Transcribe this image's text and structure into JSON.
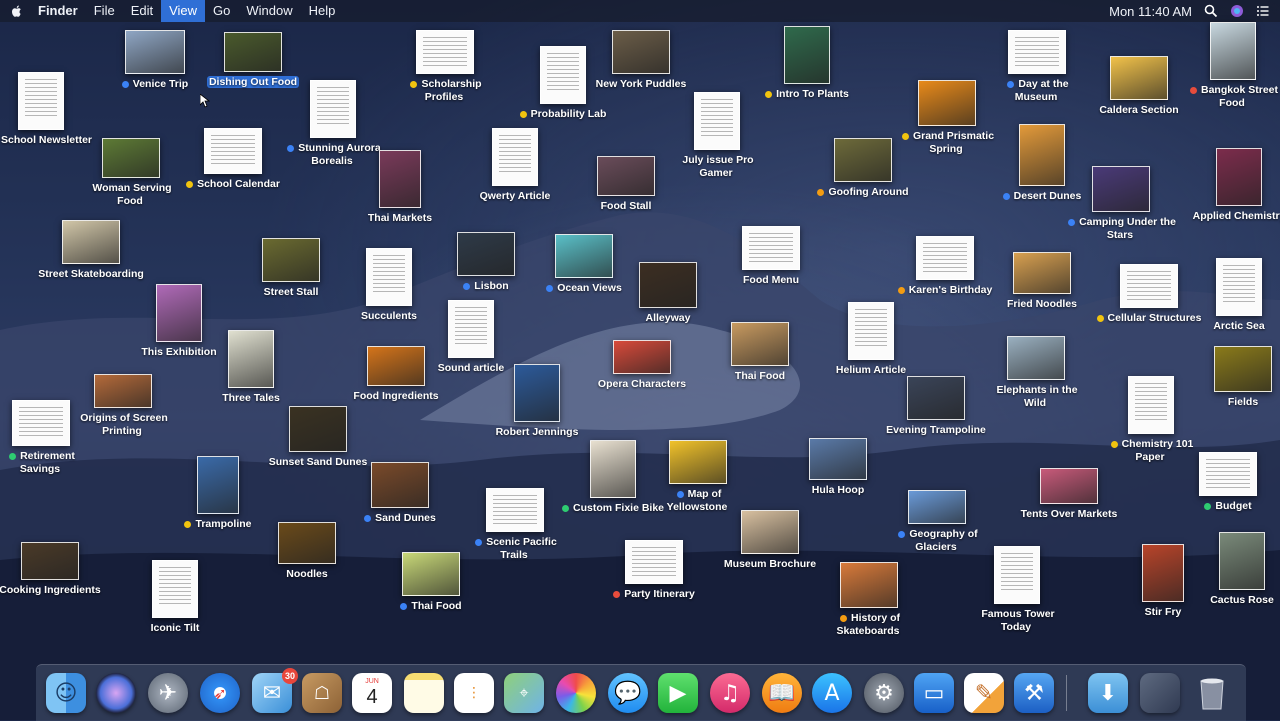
{
  "menubar": {
    "app": "Finder",
    "items": [
      "File",
      "Edit",
      "View",
      "Go",
      "Window",
      "Help"
    ],
    "active_item": "View",
    "clock": "Mon 11:40 AM"
  },
  "desktop_items": [
    {
      "label": "Venice Trip",
      "tag": "#3b82f6",
      "selected": false
    },
    {
      "label": "Dishing Out Food",
      "tag": "",
      "selected": true
    },
    {
      "label": "School Newsletter",
      "tag": "#e74c3c",
      "selected": false
    },
    {
      "label": "Woman Serving Food",
      "tag": "",
      "selected": false
    },
    {
      "label": "School Calendar",
      "tag": "#f1c40f",
      "selected": false
    },
    {
      "label": "Stunning Aurora Borealis",
      "tag": "#3b82f6",
      "selected": false
    },
    {
      "label": "Scholarship Profiles",
      "tag": "#f1c40f",
      "selected": false
    },
    {
      "label": "Probability Lab",
      "tag": "#f1c40f",
      "selected": false
    },
    {
      "label": "New York Puddles",
      "tag": "",
      "selected": false
    },
    {
      "label": "Intro To Plants",
      "tag": "#f1c40f",
      "selected": false
    },
    {
      "label": "Day at the Museum",
      "tag": "#3b82f6",
      "selected": false
    },
    {
      "label": "Caldera Section",
      "tag": "",
      "selected": false
    },
    {
      "label": "Bangkok Street Food",
      "tag": "#e74c3c",
      "selected": false
    },
    {
      "label": "July issue Pro Gamer",
      "tag": "",
      "selected": false
    },
    {
      "label": "Grand Prismatic Spring",
      "tag": "#f1c40f",
      "selected": false
    },
    {
      "label": "Thai Markets",
      "tag": "",
      "selected": false
    },
    {
      "label": "Qwerty Article",
      "tag": "",
      "selected": false
    },
    {
      "label": "Food Stall",
      "tag": "",
      "selected": false
    },
    {
      "label": "Goofing Around",
      "tag": "#f39c12",
      "selected": false
    },
    {
      "label": "Desert Dunes",
      "tag": "#3b82f6",
      "selected": false
    },
    {
      "label": "Applied Chemistry",
      "tag": "",
      "selected": false
    },
    {
      "label": "Street Skateboarding",
      "tag": "",
      "selected": false
    },
    {
      "label": "Street Stall",
      "tag": "",
      "selected": false
    },
    {
      "label": "Succulents",
      "tag": "",
      "selected": false
    },
    {
      "label": "Lisbon",
      "tag": "#3b82f6",
      "selected": false
    },
    {
      "label": "Ocean Views",
      "tag": "#3b82f6",
      "selected": false
    },
    {
      "label": "Food Menu",
      "tag": "",
      "selected": false
    },
    {
      "label": "Camping Under the Stars",
      "tag": "#3b82f6",
      "selected": false
    },
    {
      "label": "Karen's Birthday",
      "tag": "#f39c12",
      "selected": false
    },
    {
      "label": "Fried Noodles",
      "tag": "",
      "selected": false
    },
    {
      "label": "Cellular Structures",
      "tag": "#f1c40f",
      "selected": false
    },
    {
      "label": "Arctic Sea",
      "tag": "",
      "selected": false
    },
    {
      "label": "This Exhibition",
      "tag": "",
      "selected": false
    },
    {
      "label": "Alleyway",
      "tag": "",
      "selected": false
    },
    {
      "label": "Sound article",
      "tag": "",
      "selected": false
    },
    {
      "label": "Thai Food",
      "tag": "",
      "selected": false
    },
    {
      "label": "Helium Article",
      "tag": "",
      "selected": false
    },
    {
      "label": "Three Tales",
      "tag": "",
      "selected": false
    },
    {
      "label": "Food Ingredients",
      "tag": "",
      "selected": false
    },
    {
      "label": "Opera Characters",
      "tag": "",
      "selected": false
    },
    {
      "label": "Elephants in the Wild",
      "tag": "",
      "selected": false
    },
    {
      "label": "Fields",
      "tag": "",
      "selected": false
    },
    {
      "label": "Origins of Screen Printing",
      "tag": "",
      "selected": false
    },
    {
      "label": "Robert Jennings",
      "tag": "",
      "selected": false
    },
    {
      "label": "Evening Trampoline",
      "tag": "",
      "selected": false
    },
    {
      "label": "Chemistry 101 Paper",
      "tag": "#f1c40f",
      "selected": false
    },
    {
      "label": "Retirement Savings",
      "tag": "#2ecc71",
      "selected": false
    },
    {
      "label": "Sunset Sand Dunes",
      "tag": "",
      "selected": false
    },
    {
      "label": "Custom Fixie Bike",
      "tag": "#2ecc71",
      "selected": false
    },
    {
      "label": "Map of Yellowstone",
      "tag": "#3b82f6",
      "selected": false
    },
    {
      "label": "Hula Hoop",
      "tag": "",
      "selected": false
    },
    {
      "label": "Trampoline",
      "tag": "#f1c40f",
      "selected": false
    },
    {
      "label": "Sand Dunes",
      "tag": "#3b82f6",
      "selected": false
    },
    {
      "label": "Tents Over Markets",
      "tag": "",
      "selected": false
    },
    {
      "label": "Budget",
      "tag": "#2ecc71",
      "selected": false
    },
    {
      "label": "Scenic Pacific Trails",
      "tag": "#3b82f6",
      "selected": false
    },
    {
      "label": "Museum Brochure",
      "tag": "",
      "selected": false
    },
    {
      "label": "Geography of Glaciers",
      "tag": "#3b82f6",
      "selected": false
    },
    {
      "label": "Cooking Ingredients",
      "tag": "",
      "selected": false
    },
    {
      "label": "Noodles",
      "tag": "",
      "selected": false
    },
    {
      "label": "Thai Food",
      "tag": "#3b82f6",
      "selected": false
    },
    {
      "label": "Party Itinerary",
      "tag": "#e74c3c",
      "selected": false
    },
    {
      "label": "Iconic Tilt",
      "tag": "",
      "selected": false
    },
    {
      "label": "History of Skateboards",
      "tag": "#f39c12",
      "selected": false
    },
    {
      "label": "Famous Tower Today",
      "tag": "",
      "selected": false
    },
    {
      "label": "Stir Fry",
      "tag": "",
      "selected": false
    },
    {
      "label": "Cactus Rose",
      "tag": "",
      "selected": false
    }
  ],
  "dock": {
    "calendar_month": "JUN",
    "calendar_day": "4",
    "mail_badge": "30",
    "icons": [
      "finder-icon",
      "siri-icon",
      "launchpad-icon",
      "safari-icon",
      "mail-icon",
      "contacts-icon",
      "calendar-icon",
      "notes-icon",
      "reminders-icon",
      "maps-icon",
      "photos-icon",
      "messages-icon",
      "facetime-icon",
      "itunes-icon",
      "ibooks-icon",
      "app-store-icon",
      "system-preferences-icon",
      "keynote-icon",
      "pages-icon",
      "xcode-icon",
      "downloads-folder-icon",
      "recent-stack-icon",
      "trash-icon"
    ]
  }
}
